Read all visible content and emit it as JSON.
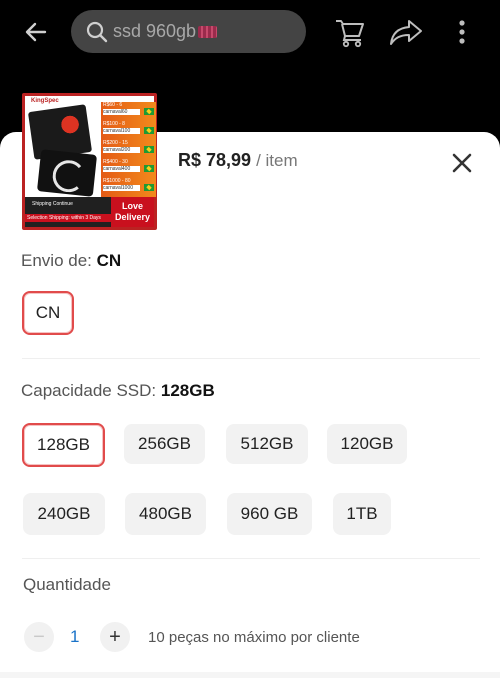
{
  "header": {
    "search": {
      "query": "ssd 960gb"
    },
    "icons": {
      "back": "arrow-left-icon",
      "search": "search-icon",
      "cart": "cart-icon",
      "share": "share-arrow-icon",
      "more": "more-vertical-icon"
    }
  },
  "product": {
    "price": "R$ 78,99",
    "price_unit": "/ item",
    "thumbnail": {
      "brand": "KingSpec",
      "promos": [
        {
          "tier": "R$60 - 6",
          "code": "carnaval60"
        },
        {
          "tier": "R$100 - 8",
          "code": "carnaval100"
        },
        {
          "tier": "R$200 - 15",
          "code": "carnaval200"
        },
        {
          "tier": "R$400 - 30",
          "code": "carnaval400"
        },
        {
          "tier": "R$1000 - 80",
          "code": "carnaval1000"
        }
      ],
      "shipping_text": "Shipping Continue",
      "selection_text": "Selection Shipping: within 3 Days",
      "love_delivery": "Love Delivery"
    }
  },
  "shipping": {
    "label": "Envio de:",
    "selected": "CN",
    "options": [
      "CN"
    ]
  },
  "capacity": {
    "label": "Capacidade SSD:",
    "selected": "128GB",
    "options": [
      "128GB",
      "256GB",
      "512GB",
      "120GB",
      "240GB",
      "480GB",
      "960 GB",
      "1TB"
    ]
  },
  "quantity": {
    "label": "Quantidade",
    "value": "1",
    "minus": "−",
    "plus": "+",
    "note": "10 peças no máximo por cliente"
  },
  "colors": {
    "accent": "#e14b4b",
    "quantity_value": "#1a73c8",
    "chip_bg": "#f2f2f2"
  }
}
